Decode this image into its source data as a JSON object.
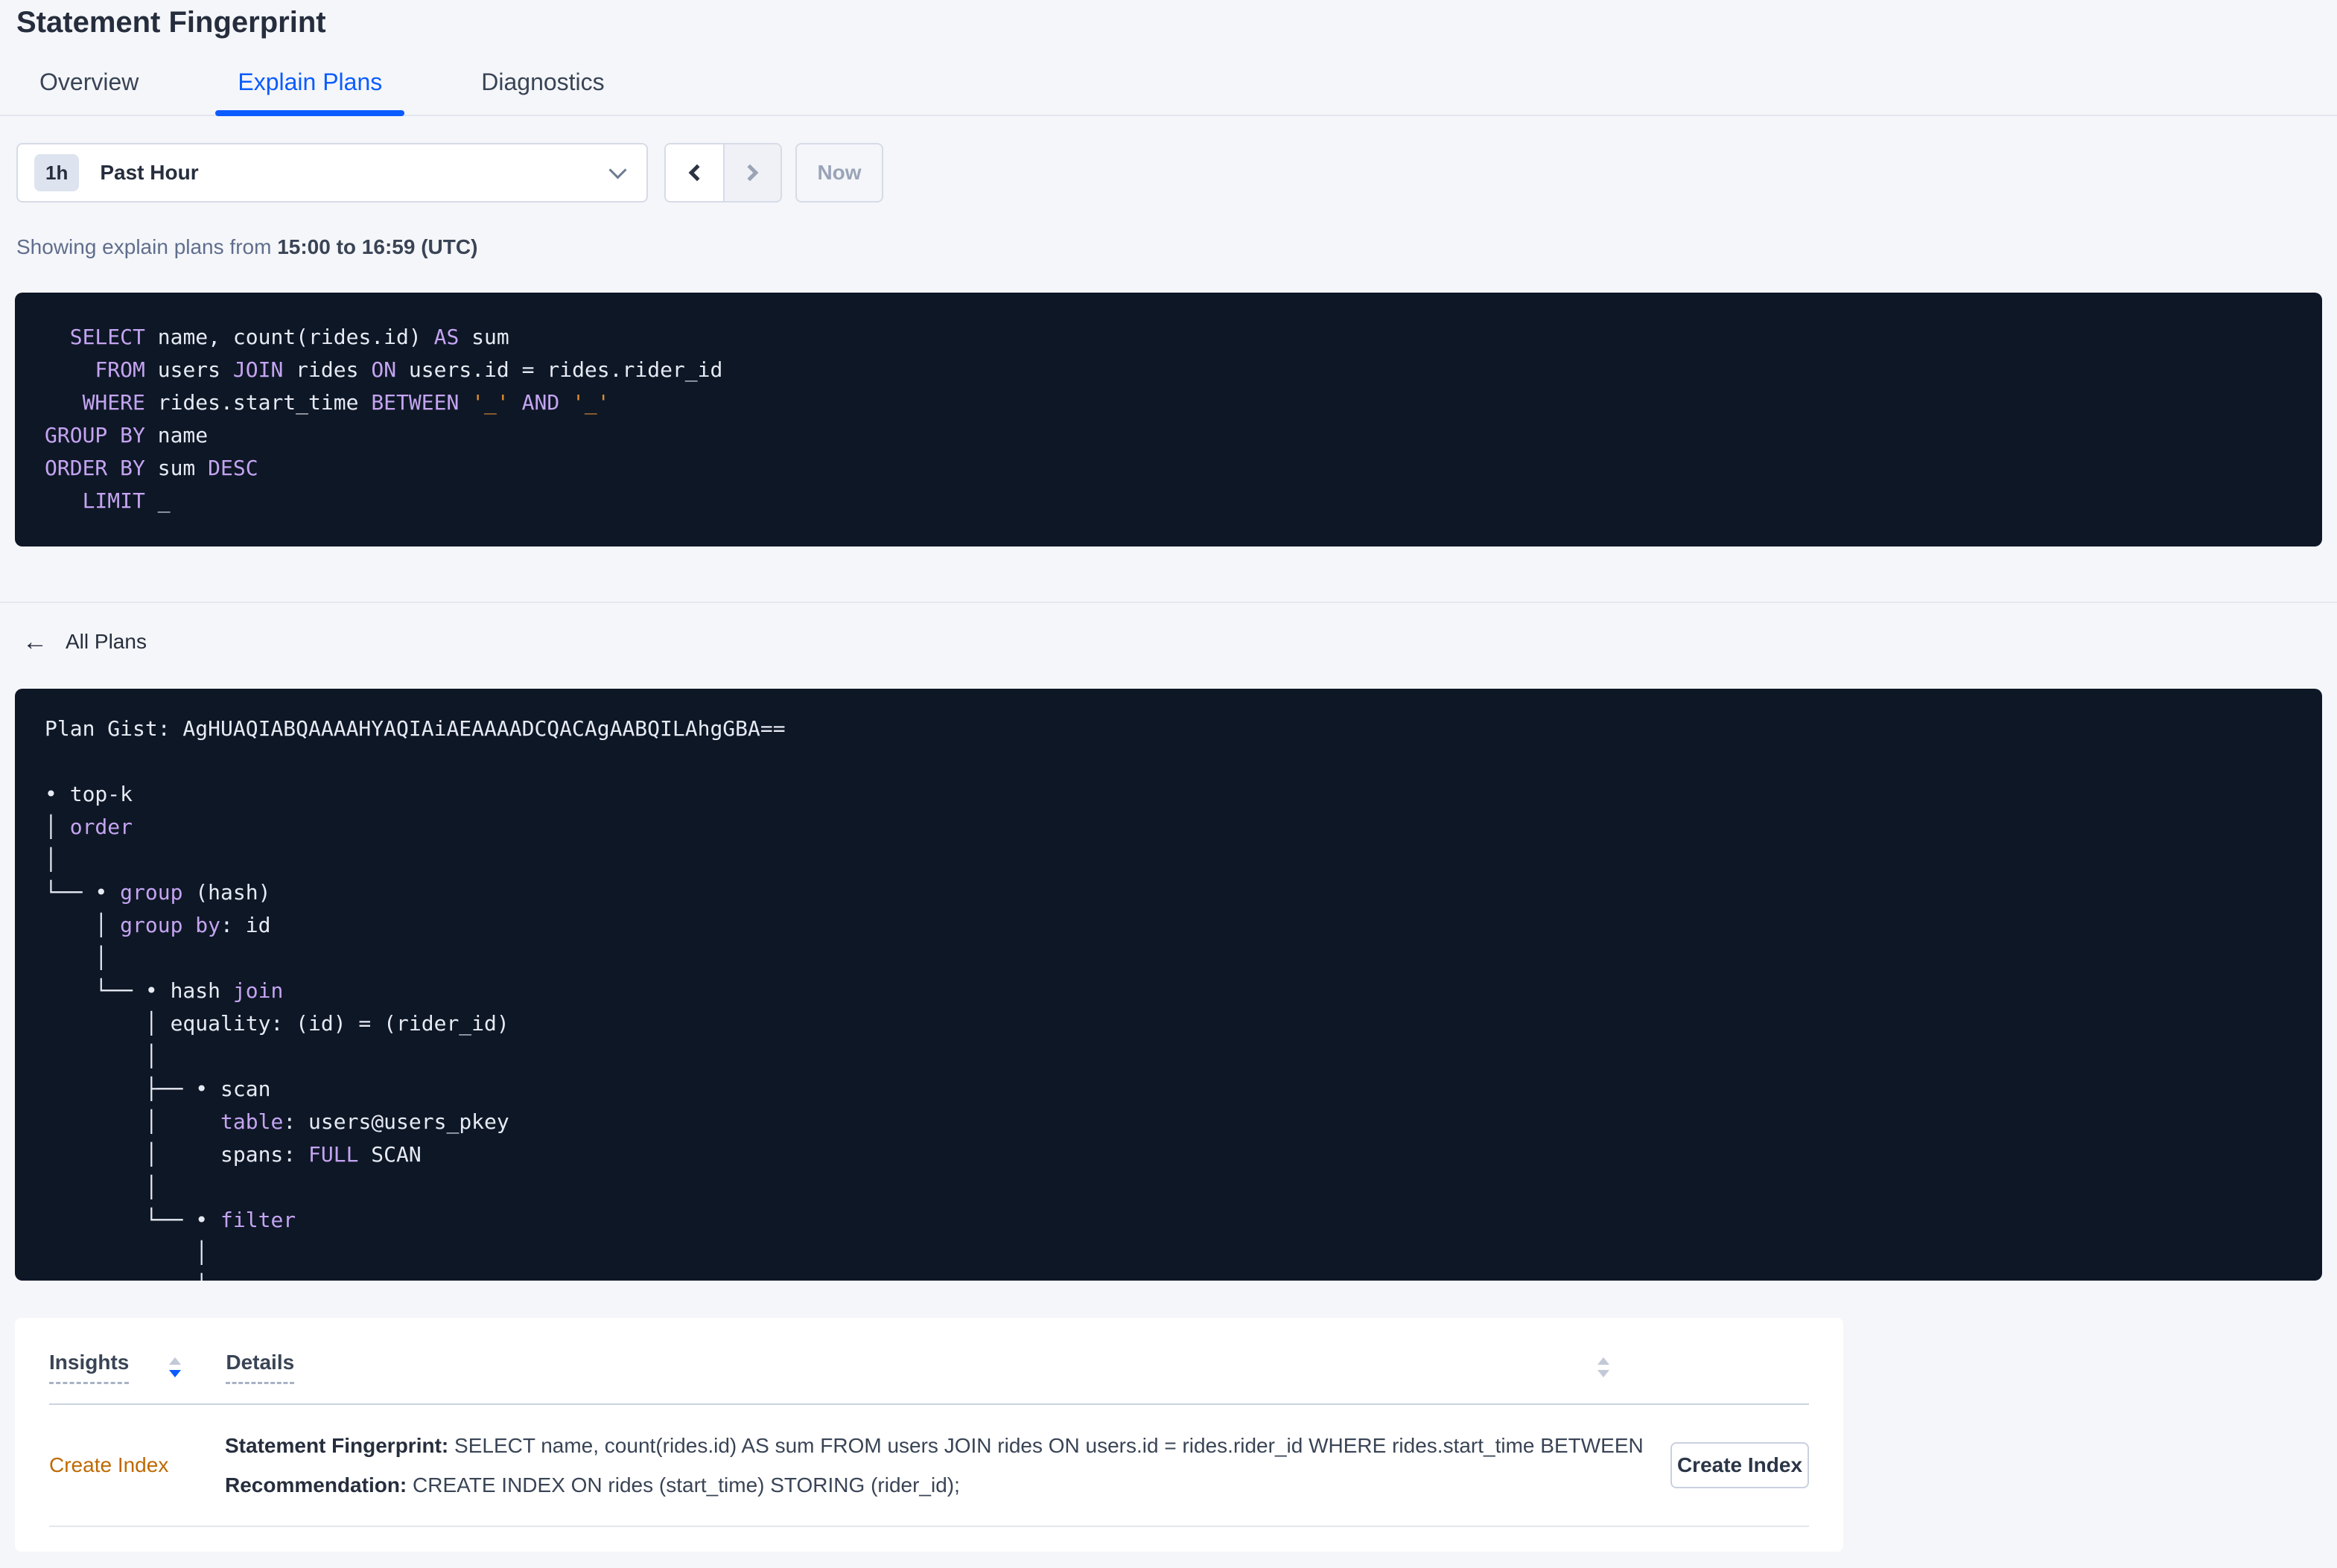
{
  "page": {
    "title": "Statement Fingerprint"
  },
  "tabs": [
    {
      "label": "Overview",
      "active": false
    },
    {
      "label": "Explain Plans",
      "active": true
    },
    {
      "label": "Diagnostics",
      "active": false
    }
  ],
  "time_picker": {
    "badge": "1h",
    "label": "Past Hour",
    "now_label": "Now",
    "prev_enabled": true,
    "next_enabled": false
  },
  "showing": {
    "prefix": "Showing explain plans from ",
    "range": "15:00 to 16:59 (UTC)"
  },
  "sql": {
    "lines": [
      [
        {
          "t": "  "
        },
        {
          "t": "SELECT",
          "c": "kw"
        },
        {
          "t": " name, count(rides.id) "
        },
        {
          "t": "AS",
          "c": "kw"
        },
        {
          "t": " sum"
        }
      ],
      [
        {
          "t": "    "
        },
        {
          "t": "FROM",
          "c": "kw"
        },
        {
          "t": " users "
        },
        {
          "t": "JOIN",
          "c": "kw"
        },
        {
          "t": " rides "
        },
        {
          "t": "ON",
          "c": "kw"
        },
        {
          "t": " users.id = rides.rider_id"
        }
      ],
      [
        {
          "t": "   "
        },
        {
          "t": "WHERE",
          "c": "kw"
        },
        {
          "t": " rides.start_time "
        },
        {
          "t": "BETWEEN",
          "c": "kw"
        },
        {
          "t": " "
        },
        {
          "t": "'_'",
          "c": "lit"
        },
        {
          "t": " "
        },
        {
          "t": "AND",
          "c": "kw"
        },
        {
          "t": " "
        },
        {
          "t": "'_'",
          "c": "lit"
        }
      ],
      [
        {
          "t": "GROUP BY",
          "c": "kw"
        },
        {
          "t": " name"
        }
      ],
      [
        {
          "t": "ORDER BY",
          "c": "kw"
        },
        {
          "t": " sum "
        },
        {
          "t": "DESC",
          "c": "kw"
        }
      ],
      [
        {
          "t": "   "
        },
        {
          "t": "LIMIT",
          "c": "kw"
        },
        {
          "t": " _"
        }
      ]
    ]
  },
  "all_plans": {
    "arrow": "←",
    "label": "All Plans"
  },
  "plan": {
    "lines": [
      [
        {
          "t": "Plan Gist: AgHUAQIABQAAAAHYAQIAiAEAAAADCQACAgAABQILAhgGBA=="
        }
      ],
      [],
      [
        {
          "t": "• top-k"
        }
      ],
      [
        {
          "t": "│ "
        },
        {
          "t": "order",
          "c": "kw"
        }
      ],
      [
        {
          "t": "│"
        }
      ],
      [
        {
          "t": "└── • "
        },
        {
          "t": "group",
          "c": "kw"
        },
        {
          "t": " (hash)"
        }
      ],
      [
        {
          "t": "    │ "
        },
        {
          "t": "group by",
          "c": "kw"
        },
        {
          "t": ": id"
        }
      ],
      [
        {
          "t": "    │"
        }
      ],
      [
        {
          "t": "    └── • hash "
        },
        {
          "t": "join",
          "c": "kw"
        }
      ],
      [
        {
          "t": "        │ equality: (id) = (rider_id)"
        }
      ],
      [
        {
          "t": "        │"
        }
      ],
      [
        {
          "t": "        ├── • scan"
        }
      ],
      [
        {
          "t": "        │     "
        },
        {
          "t": "table",
          "c": "kw"
        },
        {
          "t": ": users@users_pkey"
        }
      ],
      [
        {
          "t": "        │     spans: "
        },
        {
          "t": "FULL",
          "c": "kw"
        },
        {
          "t": " SCAN"
        }
      ],
      [
        {
          "t": "        │"
        }
      ],
      [
        {
          "t": "        └── • "
        },
        {
          "t": "filter",
          "c": "kw"
        }
      ],
      [
        {
          "t": "            │"
        }
      ],
      [
        {
          "t": "            │"
        }
      ]
    ]
  },
  "insights": {
    "columns": [
      {
        "label": "Insights",
        "sorted": "desc"
      },
      {
        "label": "Details",
        "sorted": "none"
      }
    ],
    "row": {
      "insight": "Create Index",
      "statement_label": "Statement Fingerprint:",
      "statement_text": " SELECT name, count(rides.id) AS sum FROM users JOIN rides ON users.id = rides.rider_id WHERE rides.start_time BETWEEN '_…",
      "recommendation_label": "Recommendation:",
      "recommendation_text": " CREATE INDEX ON rides (start_time) STORING (rider_id);",
      "button": "Create Index"
    }
  },
  "ui_colors": {
    "accent_blue": "#0b5cff",
    "code_background": "#0e1726",
    "code_keyword": "#c4a4f1",
    "code_literal": "#dd8e31",
    "insight_link": "#bf6a02"
  }
}
